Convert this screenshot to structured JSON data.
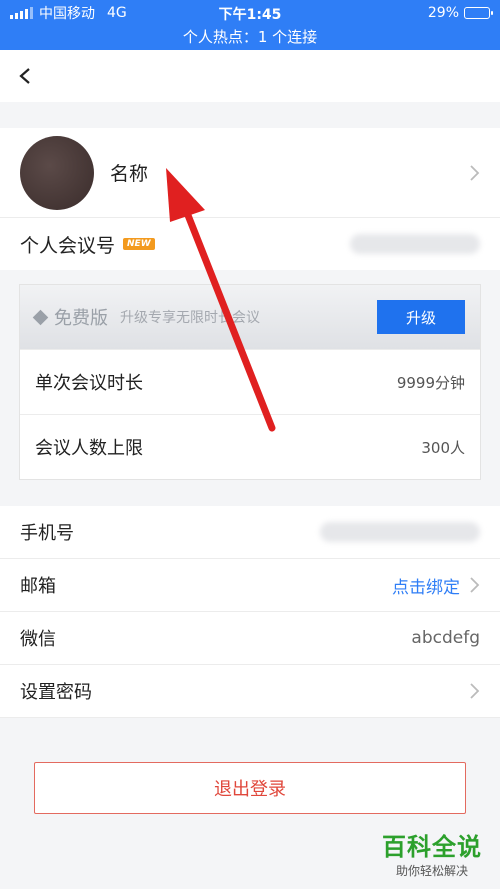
{
  "status_bar": {
    "carrier": "中国移动",
    "network": "4G",
    "time": "下午1:45",
    "battery": "29%",
    "battery_level": 0.29,
    "hotspot": "个人热点：1 个连接"
  },
  "profile": {
    "name": "名称"
  },
  "meeting": {
    "label": "个人会议号",
    "badge": "NEW"
  },
  "plan": {
    "name": "免费版",
    "description": "升级专享无限时长会议",
    "upgrade_label": "升级",
    "rows": [
      {
        "label": "单次会议时长",
        "value": "9999分钟"
      },
      {
        "label": "会议人数上限",
        "value": "300人"
      }
    ]
  },
  "account": {
    "phone_label": "手机号",
    "email_label": "邮箱",
    "email_action": "点击绑定",
    "wechat_label": "微信",
    "wechat_value": "abcdefg",
    "password_label": "设置密码"
  },
  "logout_label": "退出登录",
  "watermark": {
    "title": "百科全说",
    "subtitle": "助你轻松解决"
  },
  "colors": {
    "accent": "#2f7ef6",
    "danger": "#e0473b",
    "badge": "#f39a1e",
    "annotation_arrow": "#e02020"
  },
  "icons": [
    "signal-icon",
    "battery-icon",
    "back-icon",
    "chevron-right-icon",
    "diamond-icon",
    "arrow-annotation"
  ]
}
